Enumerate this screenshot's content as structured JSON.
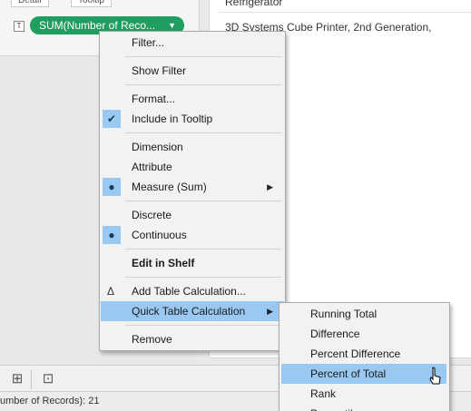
{
  "marks_card": {
    "detail_label": "Detail",
    "tooltip_label": "Tooltip",
    "text_icon": "T",
    "pill_label": "SUM(Number of Reco...",
    "pill_caret": "▼"
  },
  "view": {
    "rows": [
      "Refrigerator",
      "3D Systems Cube Printer, 2nd Generation,"
    ]
  },
  "context_menu": {
    "filter": "Filter...",
    "show_filter": "Show Filter",
    "format": "Format...",
    "include_in_tooltip": "Include in Tooltip",
    "dimension": "Dimension",
    "attribute": "Attribute",
    "measure_sum": "Measure (Sum)",
    "discrete": "Discrete",
    "continuous": "Continuous",
    "edit_in_shelf": "Edit in Shelf",
    "add_table_calculation": "Add Table Calculation...",
    "quick_table_calculation": "Quick Table Calculation",
    "remove": "Remove",
    "check_glyph": "✔",
    "bullet_glyph": "●",
    "delta_glyph": "Δ",
    "submenu_arrow": "▶"
  },
  "quick_table_submenu": {
    "items": [
      "Running Total",
      "Difference",
      "Percent Difference",
      "Percent of Total",
      "Rank",
      "Percentile"
    ],
    "selected": "Percent of Total"
  },
  "tab_strip": {
    "new_worksheet_icon": "⊞",
    "new_dashboard_icon": "⊡"
  },
  "status_bar": {
    "text": "umber of Records): 21"
  },
  "colors": {
    "pill_green": "#1f9e5f",
    "menu_highlight": "#99c9f3"
  }
}
